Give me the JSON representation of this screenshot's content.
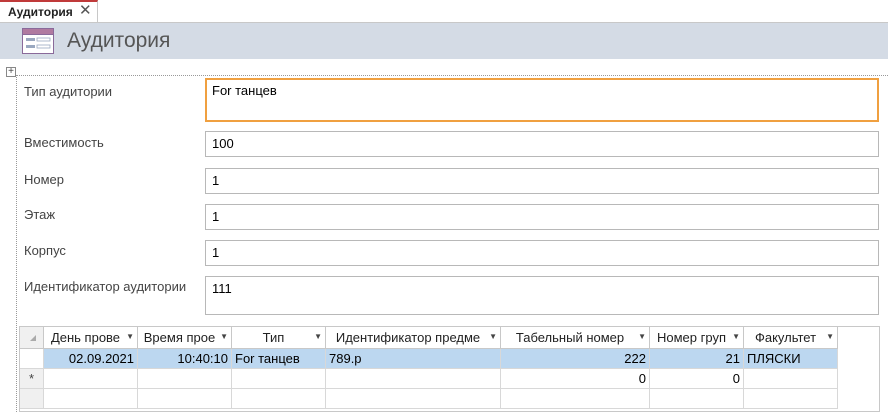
{
  "tab": {
    "label": "Аудитория"
  },
  "header": {
    "title": "Аудитория"
  },
  "fields": {
    "type": {
      "label": "Тип аудитории",
      "value": "For танцев"
    },
    "capacity": {
      "label": "Вместимость",
      "value": "100"
    },
    "number": {
      "label": "Номер",
      "value": "1"
    },
    "floor": {
      "label": "Этаж",
      "value": "1"
    },
    "building": {
      "label": "Корпус",
      "value": "1"
    },
    "room_id": {
      "label": "Идентификатор аудитории",
      "value": "111"
    }
  },
  "grid": {
    "columns": [
      "День прове",
      "Время прое",
      "Тип",
      "Идентификатор предме",
      "Табельный номер",
      "Номер груп",
      "Факультет"
    ],
    "rows": [
      [
        "02.09.2021",
        "10:40:10",
        "For танцев",
        "789.p",
        "222",
        "21",
        "ПЛЯСКИ"
      ]
    ],
    "new_row": {
      "marker": "*",
      "cells": [
        "",
        "",
        "",
        "",
        "0",
        "0",
        ""
      ]
    }
  },
  "colors": {
    "header_bg": "#d4dbe5",
    "focus_border": "#f0a040",
    "selected_row": "#bcd7f0",
    "tab_accent": "#c03a3a"
  }
}
